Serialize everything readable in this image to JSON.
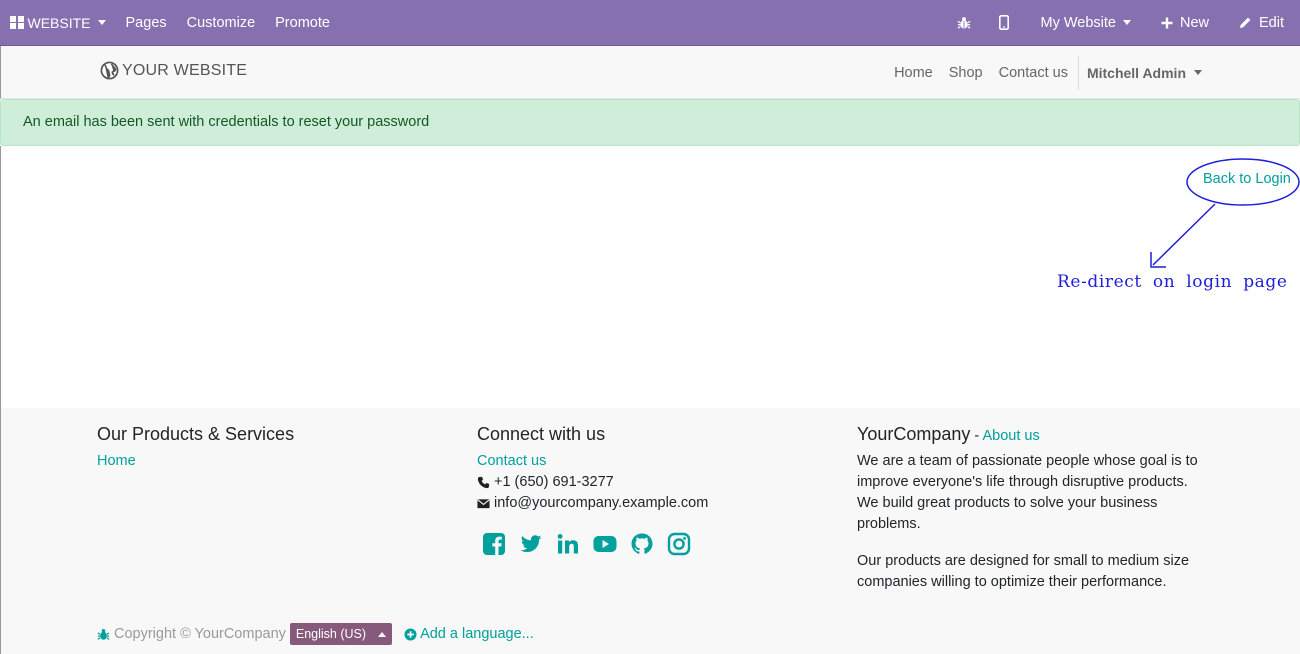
{
  "topbar": {
    "brand": "WEBSITE",
    "menu": [
      "Pages",
      "Customize",
      "Promote"
    ],
    "website_selector": "My Website",
    "new_label": "New",
    "edit_label": "Edit"
  },
  "sitenav": {
    "logo_text": "YOUR WEBSITE",
    "links": [
      "Home",
      "Shop",
      "Contact us"
    ],
    "user": "Mitchell Admin"
  },
  "alert": {
    "message": "An email has been sent with credentials to reset your password"
  },
  "main": {
    "back_to_login": "Back to Login",
    "annotation": "Re-direct on login page"
  },
  "footer": {
    "col1": {
      "title": "Our Products & Services",
      "links": [
        "Home"
      ]
    },
    "col2": {
      "title": "Connect with us",
      "contact_link": "Contact us",
      "phone": "+1 (650) 691-3277",
      "email": "info@yourcompany.example.com",
      "social": [
        "facebook-icon",
        "twitter-icon",
        "linkedin-icon",
        "youtube-icon",
        "github-icon",
        "instagram-icon"
      ]
    },
    "col3": {
      "title": "YourCompany",
      "title_sep": " - ",
      "about_link": "About us",
      "para1": "We are a team of passionate people whose goal is to improve everyone's life through disruptive products. We build great products to solve your business problems.",
      "para2": "Our products are designed for small to medium size companies willing to optimize their performance."
    },
    "copyright": "Copyright © YourCompany",
    "language": "English (US)",
    "add_language": "Add a language..."
  },
  "colors": {
    "topbar": "#8670b0",
    "link": "#00a09d",
    "alert_bg": "#cfeed9",
    "annotation": "#1e1edc"
  }
}
